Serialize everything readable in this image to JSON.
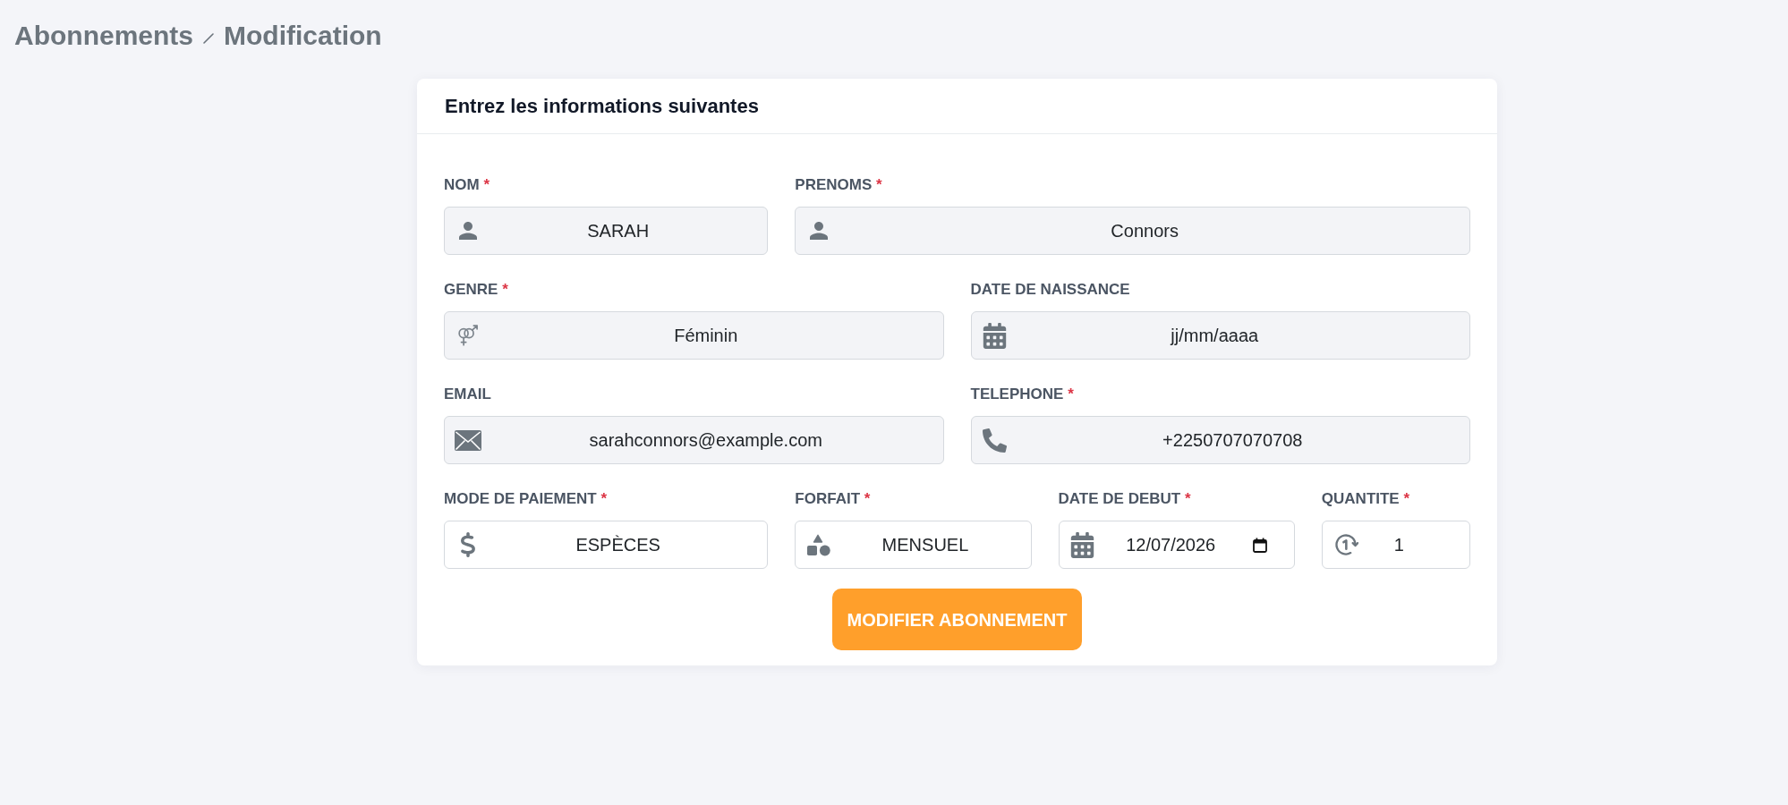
{
  "breadcrumb": [
    {
      "label": "Abonnements"
    },
    {
      "label": "Modification"
    }
  ],
  "form": {
    "title": "Entrez les informations suivantes",
    "rows": [
      [
        {
          "kind": "name",
          "label": "NOM",
          "mark": "*",
          "value": "SARAH",
          "readonly": true
        },
        {
          "kind": "name",
          "label": "PRENOMS",
          "mark": "*",
          "value": "Connors",
          "readonly": true
        }
      ],
      [
        {
          "kind": "gender",
          "label": "GENRE",
          "mark": "*",
          "value": "Féminin",
          "readonly": true
        },
        {
          "kind": "date",
          "label": "DATE DE NAISSANCE",
          "placeholder": "jj/mm/aaaa",
          "readonly": true
        }
      ],
      [
        {
          "kind": "email",
          "label": "EMAIL",
          "value": "sarahconnors@example.com",
          "readonly": true
        },
        {
          "kind": "phone",
          "label": "TELEPHONE",
          "mark": "*",
          "value": "+2250707070708",
          "readonly": true
        }
      ],
      [
        {
          "kind": "payment",
          "label": "MODE DE PAIEMENT",
          "mark": "*",
          "value": "ESPÈCES",
          "readonly": false
        },
        {
          "kind": "plan",
          "label": "FORFAIT",
          "mark": "*",
          "value": "MENSUEL",
          "readonly": false
        },
        {
          "kind": "date",
          "label": "DATE DE DEBUT",
          "mark": "*",
          "value": "12/07/2026",
          "readonly": false
        },
        {
          "kind": "quantity",
          "label": "QUANTITE",
          "mark": "*",
          "value": "1",
          "readonly": false
        }
      ]
    ],
    "submit": "MODIFIER ABONNEMENT"
  }
}
